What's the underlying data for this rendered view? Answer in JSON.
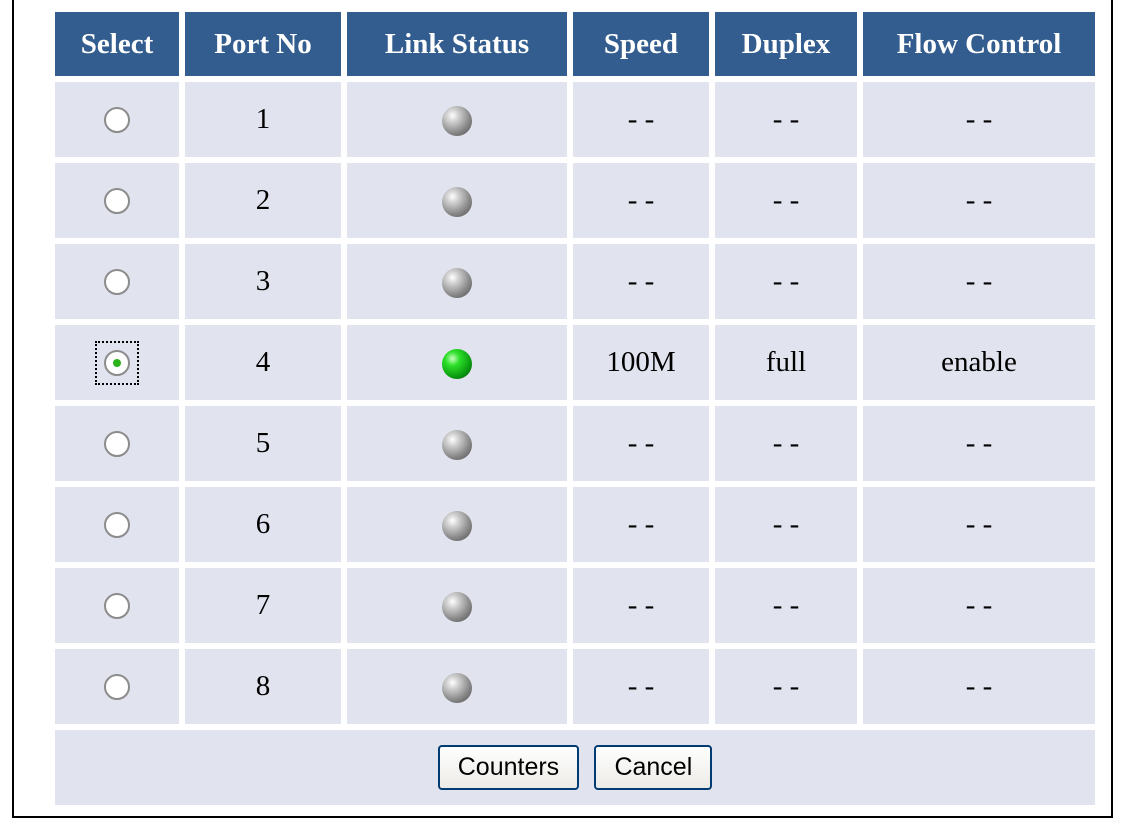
{
  "table": {
    "headers": {
      "select": "Select",
      "port_no": "Port No",
      "link_status": "Link Status",
      "speed": "Speed",
      "duplex": "Duplex",
      "flow_control": "Flow Control"
    },
    "rows": [
      {
        "selected": false,
        "port": "1",
        "link": "down",
        "link_color": "#8a8a8a",
        "speed": "- -",
        "duplex": "- -",
        "flow_control": "- -"
      },
      {
        "selected": false,
        "port": "2",
        "link": "down",
        "link_color": "#8a8a8a",
        "speed": "- -",
        "duplex": "- -",
        "flow_control": "- -"
      },
      {
        "selected": false,
        "port": "3",
        "link": "down",
        "link_color": "#8a8a8a",
        "speed": "- -",
        "duplex": "- -",
        "flow_control": "- -"
      },
      {
        "selected": true,
        "port": "4",
        "link": "up",
        "link_color": "#0a9a10",
        "speed": "100M",
        "duplex": "full",
        "flow_control": "enable"
      },
      {
        "selected": false,
        "port": "5",
        "link": "down",
        "link_color": "#8a8a8a",
        "speed": "- -",
        "duplex": "- -",
        "flow_control": "- -"
      },
      {
        "selected": false,
        "port": "6",
        "link": "down",
        "link_color": "#8a8a8a",
        "speed": "- -",
        "duplex": "- -",
        "flow_control": "- -"
      },
      {
        "selected": false,
        "port": "7",
        "link": "down",
        "link_color": "#8a8a8a",
        "speed": "- -",
        "duplex": "- -",
        "flow_control": "- -"
      },
      {
        "selected": false,
        "port": "8",
        "link": "down",
        "link_color": "#8a8a8a",
        "speed": "- -",
        "duplex": "- -",
        "flow_control": "- -"
      }
    ]
  },
  "buttons": {
    "counters_label": "Counters",
    "cancel_label": "Cancel"
  },
  "colors": {
    "header_bg": "#335d8e",
    "cell_bg": "#e1e3ee",
    "link_up": "#0a9a10",
    "link_down": "#8a8a8a"
  }
}
